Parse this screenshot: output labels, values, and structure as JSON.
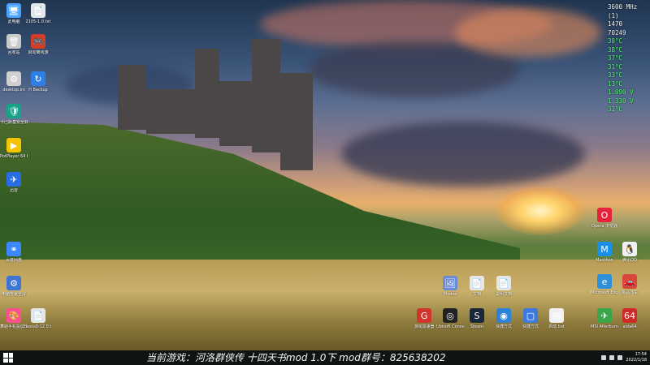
{
  "desktop_icons_left": [
    {
      "name": "pc-icon",
      "label": "此电脑",
      "color": "#4aa3ff",
      "glyph": "🖥"
    },
    {
      "name": "txt-file-icon",
      "label": "2105-1.0.txt",
      "color": "#e8e8e8",
      "glyph": "📄"
    },
    {
      "name": "recycle-bin-icon",
      "label": "回收站",
      "color": "#c9c9c9",
      "glyph": "🗑"
    },
    {
      "name": "game-launcher-icon",
      "label": "启动离线游",
      "color": "#d23d2b",
      "glyph": "🎮"
    },
    {
      "name": "ini-file-icon",
      "label": "desktop.ini",
      "color": "#cfcfcf",
      "glyph": "⚙"
    },
    {
      "name": "backup-icon",
      "label": "H Backup",
      "color": "#2d7fe6",
      "glyph": "↻"
    },
    {
      "name": "security-icon",
      "label": "卡巴斯基安全软件",
      "color": "#19a28a",
      "glyph": "🛡"
    },
    {
      "name": "potplayer-icon",
      "label": "PotPlayer 64 bit",
      "color": "#f5c400",
      "glyph": "▶"
    },
    {
      "name": "feishu-icon",
      "label": "迅雷",
      "color": "#2a6de2",
      "glyph": "✈"
    },
    {
      "name": "network-icon",
      "label": "百度网盘",
      "color": "#3c87ff",
      "glyph": "⚭"
    },
    {
      "name": "settings-app-icon",
      "label": "电脑管家全屏",
      "color": "#3d74d6",
      "glyph": "⚙"
    },
    {
      "name": "palette-icon",
      "label": "舞蹈手机投屏工具",
      "color": "#ff4f93",
      "glyph": "🎨"
    },
    {
      "name": "pdf-icon",
      "label": "hexiu0-12.0.txt",
      "color": "#e6e6e6",
      "glyph": "📄"
    }
  ],
  "desktop_icons_right": [
    {
      "name": "opera-icon",
      "label": "Opera 浏览器",
      "color": "#e7233b",
      "glyph": "O"
    },
    {
      "name": "maxthon-icon",
      "label": "Maxthon",
      "color": "#1a8fe6",
      "glyph": "M"
    },
    {
      "name": "qq-icon",
      "label": "腾讯QQ",
      "color": "#f1f1f1",
      "glyph": "🐧"
    },
    {
      "name": "edge-icon",
      "label": "Microsoft Edge",
      "color": "#2b8fd9",
      "glyph": "e"
    },
    {
      "name": "car-icon",
      "label": "极品飞车",
      "color": "#d9483c",
      "glyph": "🚗"
    },
    {
      "name": "msi-icon",
      "label": "MSI Afterburner",
      "color": "#39a749",
      "glyph": "✈"
    },
    {
      "name": "aida64-icon",
      "label": "aida64",
      "color": "#cf2a2a",
      "glyph": "64"
    }
  ],
  "desktop_icons_bottom": [
    {
      "name": "photo-icon",
      "label": "Photos",
      "color": "#6b8bd6",
      "glyph": "🖼"
    },
    {
      "name": "doc1-icon",
      "label": "文档",
      "color": "#e6e6e6",
      "glyph": "📄"
    },
    {
      "name": "doc2-icon",
      "label": "说明文档",
      "color": "#e6e6e6",
      "glyph": "📄"
    },
    {
      "name": "game1-icon",
      "label": "游戏加速器",
      "color": "#d0342c",
      "glyph": "G"
    },
    {
      "name": "game2-icon",
      "label": "Ubisoft Connect",
      "color": "#222222",
      "glyph": "◎"
    },
    {
      "name": "steam-icon",
      "label": "Steam",
      "color": "#1b2838",
      "glyph": "S"
    },
    {
      "name": "swirl-icon",
      "label": "快捷方式",
      "color": "#2b82d6",
      "glyph": "◉"
    },
    {
      "name": "window-icon",
      "label": "快捷方式",
      "color": "#3c7ae0",
      "glyph": "▢"
    },
    {
      "name": "bat-icon",
      "label": "启动.bat",
      "color": "#f0f0f0",
      "glyph": "▤"
    }
  ],
  "monitor": {
    "mhz": "3600 MHz",
    "lines": [
      "(1)",
      "1470",
      "70249",
      "38°C",
      "38°C",
      "37°C",
      "31°C",
      "33°C",
      "13°C",
      "1.090 V",
      "1.330 V",
      "32°C"
    ]
  },
  "taskbar": {
    "banner": "当前游戏：河洛群侠传 十四天书mod 1.0下  mod群号：825638202",
    "time": "17:54",
    "date": "2022/1/18"
  }
}
